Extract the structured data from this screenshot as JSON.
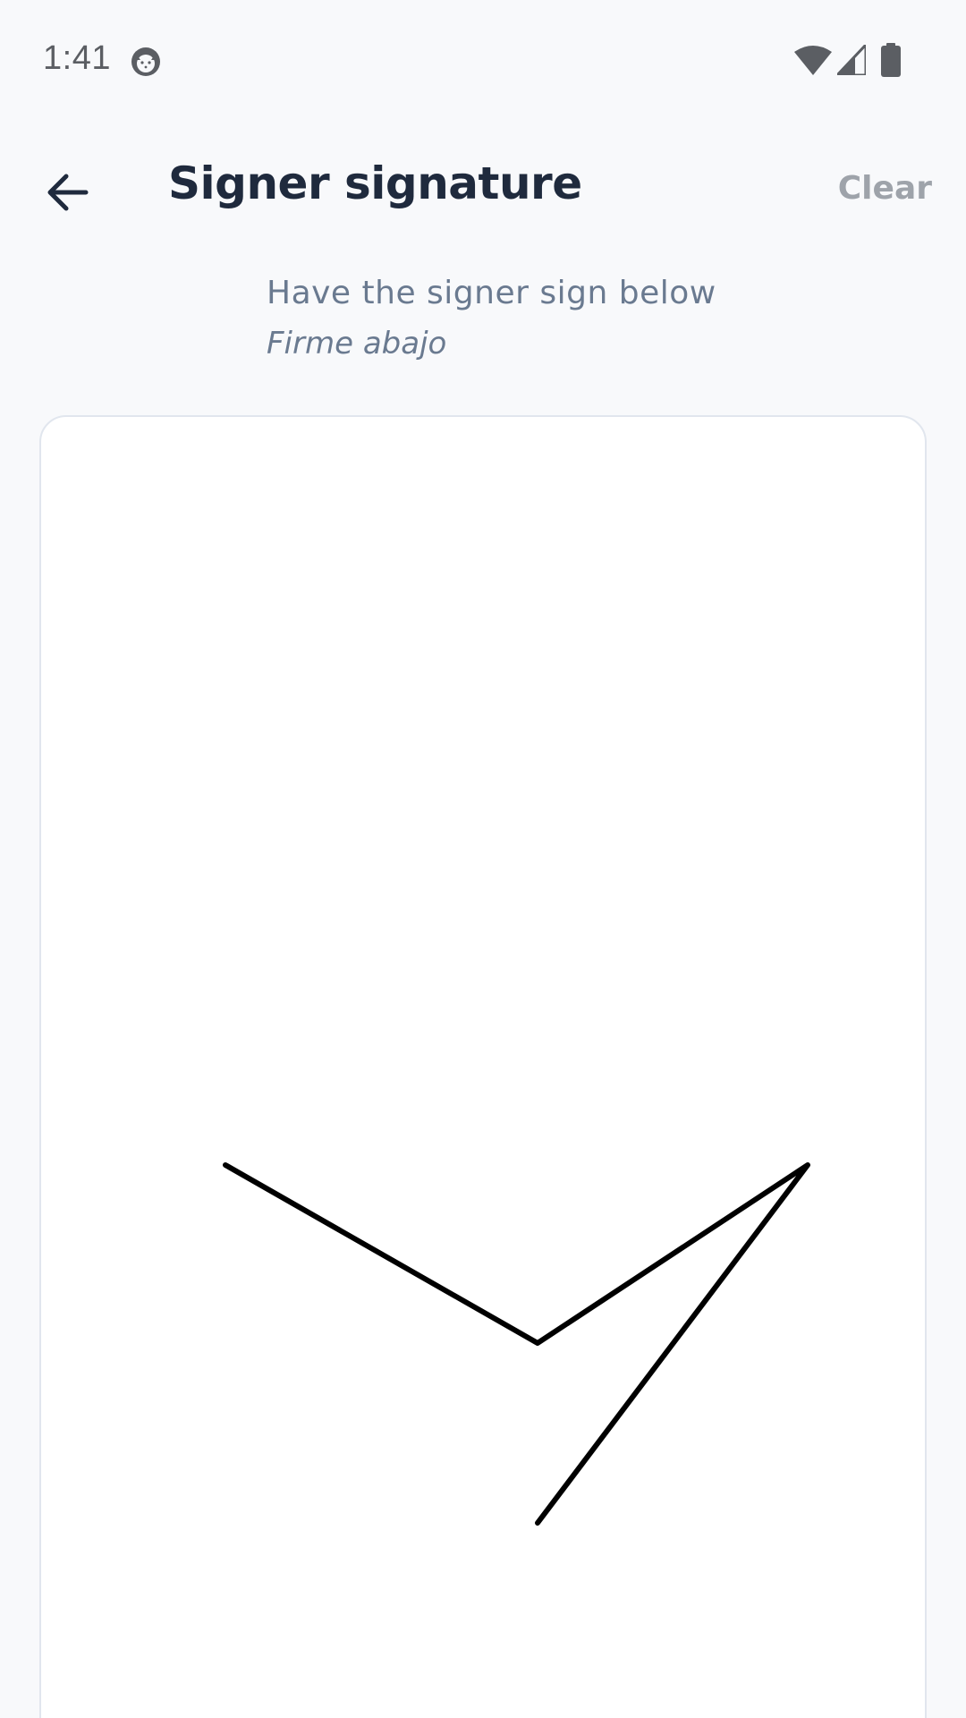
{
  "status_bar": {
    "time": "1:41",
    "icons": [
      "app-notification-icon",
      "wifi-icon",
      "signal-icon",
      "battery-icon"
    ]
  },
  "header": {
    "back_icon": "arrow-left-icon",
    "title": "Signer signature",
    "clear_label": "Clear"
  },
  "instructions": {
    "primary": "Have the signer sign below",
    "secondary": "Firme abajo"
  },
  "signature_pad": {
    "stroke_color": "#000000",
    "background": "#ffffff",
    "border_color": "#e1e6ee"
  },
  "colors": {
    "title": "#1f2a3d",
    "instruction_text": "#6a7a90",
    "clear_disabled": "#9ea3aa",
    "page_background": "#f8f9fb"
  }
}
